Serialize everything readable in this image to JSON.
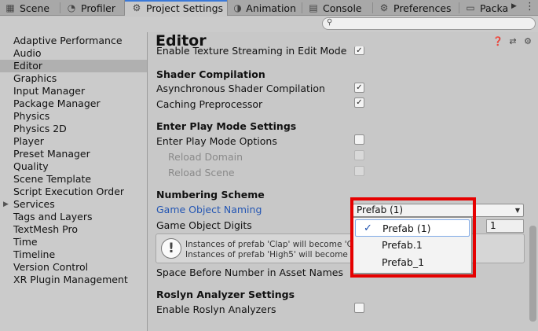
{
  "tabs": [
    {
      "label": "Scene",
      "icon": "scene-icon"
    },
    {
      "label": "Profiler",
      "icon": "profiler-icon"
    },
    {
      "label": "Project Settings",
      "icon": "gear-icon",
      "active": true
    },
    {
      "label": "Animation",
      "icon": "animation-icon"
    },
    {
      "label": "Console",
      "icon": "console-icon"
    },
    {
      "label": "Preferences",
      "icon": "gear-icon"
    },
    {
      "label": "Packa",
      "icon": "package-icon"
    }
  ],
  "search": {
    "placeholder": ""
  },
  "sidebar": {
    "items": [
      {
        "label": "Adaptive Performance"
      },
      {
        "label": "Audio"
      },
      {
        "label": "Editor",
        "selected": true
      },
      {
        "label": "Graphics"
      },
      {
        "label": "Input Manager"
      },
      {
        "label": "Package Manager"
      },
      {
        "label": "Physics"
      },
      {
        "label": "Physics 2D"
      },
      {
        "label": "Player"
      },
      {
        "label": "Preset Manager"
      },
      {
        "label": "Quality"
      },
      {
        "label": "Scene Template"
      },
      {
        "label": "Script Execution Order"
      },
      {
        "label": "Services",
        "expandable": true
      },
      {
        "label": "Tags and Layers"
      },
      {
        "label": "TextMesh Pro"
      },
      {
        "label": "Time"
      },
      {
        "label": "Timeline"
      },
      {
        "label": "Version Control"
      },
      {
        "label": "XR Plugin Management"
      }
    ]
  },
  "main": {
    "title": "Editor",
    "rows": {
      "texture_streaming": "Enable Texture Streaming in Edit Mode",
      "shader_header": "Shader Compilation",
      "async_shader": "Asynchronous Shader Compilation",
      "caching_preprocessor": "Caching Preprocessor",
      "playmode_header": "Enter Play Mode Settings",
      "playmode_options": "Enter Play Mode Options",
      "reload_domain": "Reload Domain",
      "reload_scene": "Reload Scene",
      "numbering_header": "Numbering Scheme",
      "go_naming": "Game Object Naming",
      "go_digits": "Game Object Digits",
      "space_before": "Space Before Number in Asset Names",
      "roslyn_header": "Roslyn Analyzer Settings",
      "roslyn_enable": "Enable Roslyn Analyzers"
    },
    "checks": {
      "texture_streaming": "✓",
      "async_shader": "✓",
      "caching_preprocessor": "✓",
      "playmode_options": "",
      "reload_domain": "",
      "reload_scene": "",
      "roslyn_enable": ""
    },
    "help_lines": [
      "Instances of prefab 'Clap' will become 'Clap",
      "Instances of prefab 'High5' will become 'High"
    ],
    "digits_value": "1",
    "naming_dropdown": {
      "selected": "Prefab (1)",
      "options": [
        "Prefab (1)",
        "Prefab.1",
        "Prefab_1"
      ],
      "check_glyph": "✓"
    }
  },
  "colors": {
    "accent": "#3a79d9",
    "highlight_frame": "#e60000",
    "link": "#2456b3"
  }
}
